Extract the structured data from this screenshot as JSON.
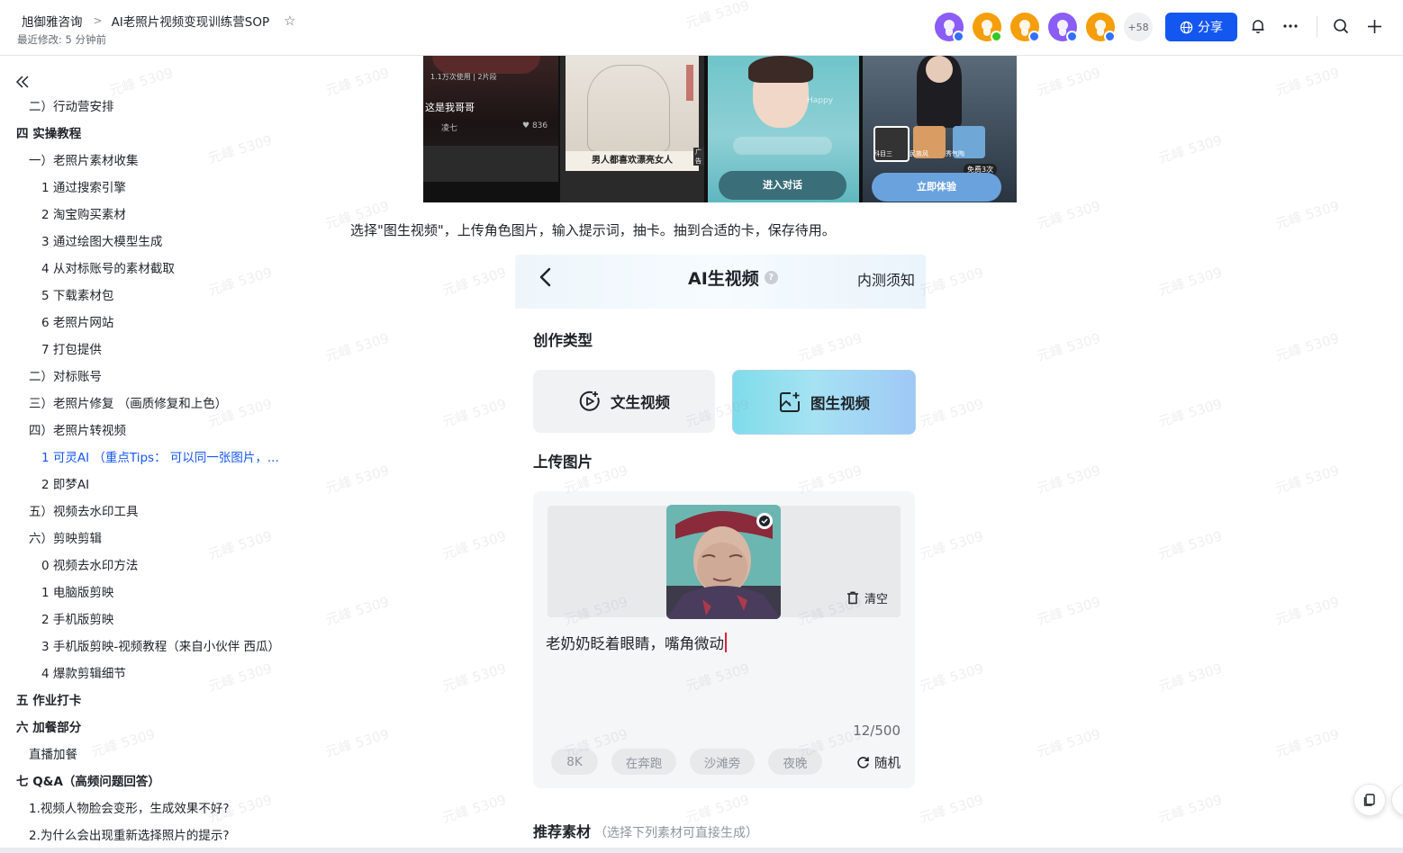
{
  "header": {
    "breadcrumb_root": "旭御雅咨询",
    "breadcrumb_sep": ">",
    "doc_title": "AI老照片视频变现训练营SOP",
    "last_modified": "最近修改: 5 分钟前",
    "more_collaborators": "+58",
    "share_label": "分享",
    "avatar_colors": [
      "#8b5cf6",
      "#f59e0b",
      "#f59e0b",
      "#8b5cf6",
      "#f59e0b"
    ]
  },
  "sidebar": {
    "items": [
      {
        "label": "二）行动营安排"
      },
      {
        "label": "四 实操教程"
      },
      {
        "label": "一）老照片素材收集"
      },
      {
        "label": "1 通过搜索引擎"
      },
      {
        "label": "2 淘宝购买素材"
      },
      {
        "label": "3 通过绘图大模型生成"
      },
      {
        "label": "4 从对标账号的素材截取"
      },
      {
        "label": "5 下载素材包"
      },
      {
        "label": "6 老照片网站"
      },
      {
        "label": "7 打包提供"
      },
      {
        "label": "二）对标账号"
      },
      {
        "label": "三）老照片修复 （画质修复和上色）"
      },
      {
        "label": "四）老照片转视频"
      },
      {
        "label": "1 可灵AI （重点Tips： 可以同一张图片，..."
      },
      {
        "label": "2 即梦AI"
      },
      {
        "label": "五）视频去水印工具"
      },
      {
        "label": "六）剪映剪辑"
      },
      {
        "label": "0 视频去水印方法"
      },
      {
        "label": "1 电脑版剪映"
      },
      {
        "label": "2 手机版剪映"
      },
      {
        "label": "3 手机版剪映-视频教程（来自小伙伴 西瓜）"
      },
      {
        "label": "4 爆款剪辑细节"
      },
      {
        "label": "五 作业打卡"
      },
      {
        "label": "六 加餐部分"
      },
      {
        "label": "直播加餐"
      },
      {
        "label": "七 Q&A（高频问题回答）"
      },
      {
        "label": "1.视频人物脸会变形，生成效果不好?"
      },
      {
        "label": "2.为什么会出现重新选择照片的提示?"
      }
    ]
  },
  "content": {
    "top_image": {
      "usage_text": "1.1万次使用 | 2片段",
      "caption_text": "这是我哥哥",
      "author": "凌七",
      "likes": "836",
      "ad_tag": "广告",
      "poster_text": "男人都喜欢漂亮女人",
      "chat_button": "进入对话",
      "try_button": "立即体验",
      "free_badge": "免费3次",
      "thumb_labels": [
        "科目三",
        "民族风",
        "秀气陶"
      ],
      "happy_text": "Happy"
    },
    "caption": "选择\"图生视频\"，上传角色图片，输入提示词，抽卡。抽到合适的卡，保存待用。",
    "app": {
      "title": "AI生视频",
      "help_mark": "?",
      "notice": "内测须知",
      "section_type": "创作类型",
      "btn_text_video": "文生视频",
      "btn_image_video": "图生视频",
      "section_upload": "上传图片",
      "clear": "清空",
      "prompt": "老奶奶眨着眼睛，嘴角微动",
      "counter": "12/500",
      "chips": [
        "8K",
        "在奔跑",
        "沙滩旁",
        "夜晚"
      ],
      "random": "随机",
      "recommend_title": "推荐素材",
      "recommend_hint": "（选择下列素材可直接生成）"
    }
  },
  "watermark": "元峰 5309"
}
